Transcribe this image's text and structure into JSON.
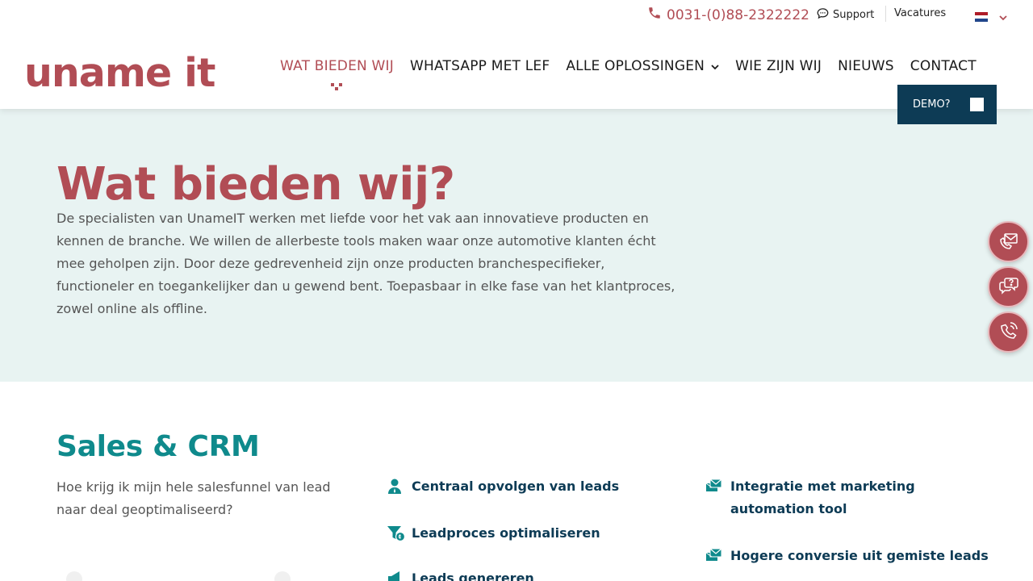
{
  "topbar": {
    "phone": "0031-(0)88-2322222",
    "support": "Support",
    "vacatures": "Vacatures",
    "language": "NL"
  },
  "logo": {
    "text": "uname it"
  },
  "nav": {
    "items": [
      {
        "label": "WAT BIEDEN WIJ"
      },
      {
        "label": "WHATSAPP MET LEF"
      },
      {
        "label": "ALLE OPLOSSINGEN"
      },
      {
        "label": "WIE ZIJN WIJ"
      },
      {
        "label": "NIEUWS"
      },
      {
        "label": "CONTACT"
      }
    ],
    "demo": "DEMO?"
  },
  "hero": {
    "title": "Wat bieden wij?",
    "text": "De specialisten van UnameIT werken met liefde voor het vak aan innovatieve producten en kennen de branche. We willen de allerbeste tools maken waar onze automotive klanten écht mee geholpen zijn. Door deze gedrevenheid zijn onze producten branchespecifieker, functioneler en toegankelijker dan u gewend bent. Toepasbaar in elke fase van het klantproces, zowel online als offline."
  },
  "floating": {
    "icons": [
      "mail-phone-icon",
      "chat-question-icon",
      "phone-support-icon"
    ]
  },
  "sales": {
    "title": "Sales & CRM",
    "subtitle": "Hoe krijg ik mijn hele salesfunnel van lead naar deal geoptimaliseerd?",
    "features": [
      {
        "label": "Centraal opvolgen van leads",
        "icon": "user-icon"
      },
      {
        "label": "Leadproces optimaliseren",
        "icon": "funnel-icon"
      },
      {
        "label": "Leads genereren",
        "icon": "megaphone-icon"
      },
      {
        "label": "Integratie met marketing automation tool",
        "icon": "mail-stack-icon"
      },
      {
        "label": "Hogere conversie uit gemiste leads",
        "icon": "mail-stack-icon"
      }
    ]
  },
  "colors": {
    "brand": "#b14d55",
    "navy": "#0d3b55",
    "teal": "#0f8a8c",
    "hero_bg": "#e8f3f2"
  }
}
